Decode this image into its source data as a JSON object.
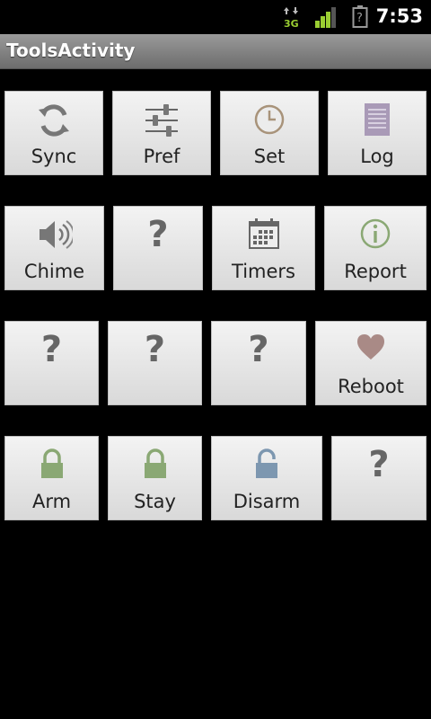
{
  "status_bar": {
    "network_label": "3G",
    "time": "7:53",
    "battery_glyph": "?"
  },
  "title_bar": {
    "title": "ToolsActivity"
  },
  "tiles": {
    "sync": {
      "label": "Sync",
      "icon": "sync-icon"
    },
    "pref": {
      "label": "Pref",
      "icon": "sliders-icon"
    },
    "set": {
      "label": "Set",
      "icon": "clock-icon"
    },
    "log": {
      "label": "Log",
      "icon": "document-icon"
    },
    "chime": {
      "label": "Chime",
      "icon": "speaker-icon"
    },
    "unknown_r2": {
      "label": "",
      "icon": "question-icon",
      "glyph": "?"
    },
    "timers": {
      "label": "Timers",
      "icon": "calendar-icon"
    },
    "report": {
      "label": "Report",
      "icon": "info-icon"
    },
    "unknown_r3a": {
      "glyph": "?"
    },
    "unknown_r3b": {
      "glyph": "?"
    },
    "unknown_r3c": {
      "glyph": "?"
    },
    "reboot": {
      "label": "Reboot",
      "icon": "heart-icon"
    },
    "arm": {
      "label": "Arm",
      "icon": "lock-closed-icon"
    },
    "stay": {
      "label": "Stay",
      "icon": "lock-closed-icon"
    },
    "disarm": {
      "label": "Disarm",
      "icon": "lock-open-icon"
    },
    "unknown_r4": {
      "glyph": "?"
    }
  },
  "colors": {
    "background": "#000000",
    "tile_top": "#f3f3f3",
    "tile_bottom": "#d9d9d9",
    "lock_green": "#8aa874",
    "lock_blue": "#7d97b0",
    "heart": "#a98a86"
  }
}
